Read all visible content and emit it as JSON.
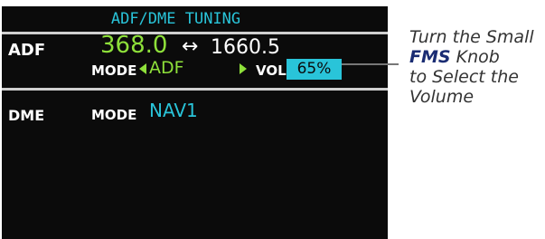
{
  "page_title": "ADF/DME TUNING",
  "adf": {
    "label": "ADF",
    "active_frequency": "368.0",
    "swap_symbol": "↔",
    "standby_frequency": "1660.5",
    "mode_label": "MODE",
    "mode_value": "ADF",
    "volume_label": "VOL",
    "volume_value": "65%"
  },
  "dme": {
    "label": "DME",
    "mode_label": "MODE",
    "mode_value": "NAV1"
  },
  "callout": {
    "line1": "Turn the Small",
    "knob": "FMS",
    "knob_suffix": " Knob",
    "line3": "to Select the",
    "line4": "Volume"
  },
  "colors": {
    "cyan": "#29c4d9",
    "green": "#8ee03a",
    "background": "#0b0b0b"
  }
}
